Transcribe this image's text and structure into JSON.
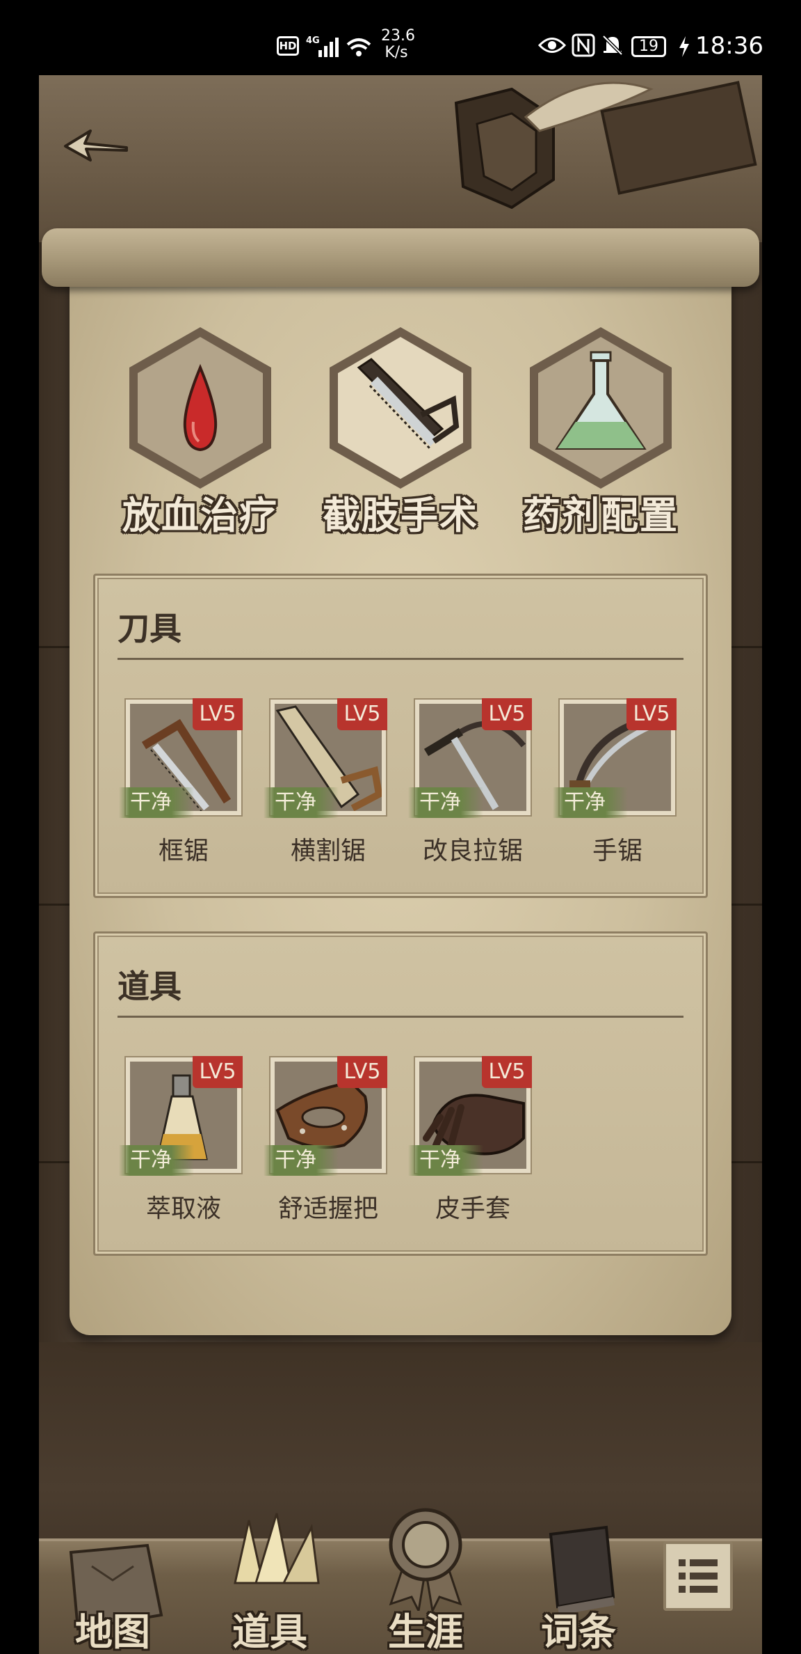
{
  "status_bar": {
    "hd": "HD",
    "network": "4G",
    "speed_value": "23.6",
    "speed_unit": "K/s",
    "battery": "19",
    "time": "18:36"
  },
  "header": {
    "back_icon": "arrow-left-icon"
  },
  "tabs": [
    {
      "label": "放血治疗",
      "icon": "blood-drop-icon",
      "selected": false
    },
    {
      "label": "截肢手术",
      "icon": "saw-icon",
      "selected": true
    },
    {
      "label": "药剂配置",
      "icon": "flask-icon",
      "selected": false
    }
  ],
  "sections": [
    {
      "title": "刀具",
      "items": [
        {
          "name": "框锯",
          "level": "LV5",
          "status": "干净",
          "icon": "frame-saw-icon"
        },
        {
          "name": "横割锯",
          "level": "LV5",
          "status": "干净",
          "icon": "crosscut-saw-icon"
        },
        {
          "name": "改良拉锯",
          "level": "LV5",
          "status": "干净",
          "icon": "bow-saw-icon"
        },
        {
          "name": "手锯",
          "level": "LV5",
          "status": "干净",
          "icon": "hand-saw-icon"
        }
      ]
    },
    {
      "title": "道具",
      "items": [
        {
          "name": "萃取液",
          "level": "LV5",
          "status": "干净",
          "icon": "extract-bottle-icon"
        },
        {
          "name": "舒适握把",
          "level": "LV5",
          "status": "干净",
          "icon": "grip-handle-icon"
        },
        {
          "name": "皮手套",
          "level": "LV5",
          "status": "干净",
          "icon": "leather-glove-icon"
        }
      ]
    }
  ],
  "bottom_nav": [
    {
      "label": "地图",
      "icon": "map-icon",
      "selected": false
    },
    {
      "label": "道具",
      "icon": "tools-icon",
      "selected": true
    },
    {
      "label": "生涯",
      "icon": "medal-icon",
      "selected": false
    },
    {
      "label": "词条",
      "icon": "book-icon",
      "selected": false
    }
  ],
  "menu_icon": "list-menu-icon",
  "colors": {
    "level_badge": "#b8342d",
    "clean_tag": "#6c8447",
    "paper": "#cdbf9e",
    "wood": "#4a3d30"
  }
}
